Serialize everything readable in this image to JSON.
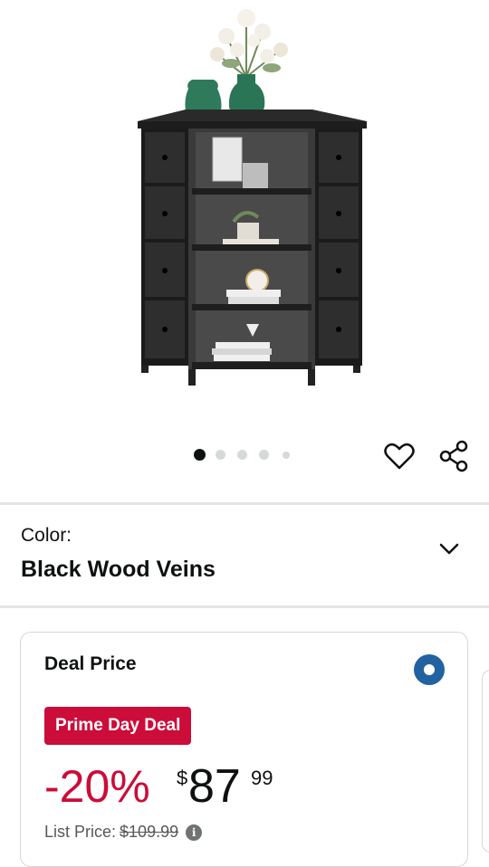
{
  "gallery": {
    "image_count": 5,
    "active_index": 0,
    "wishlist_icon": "heart-icon",
    "share_icon": "share-icon"
  },
  "color": {
    "label": "Color:",
    "value": "Black Wood Veins",
    "chevron_icon": "chevron-down-icon"
  },
  "deal": {
    "title": "Deal Price",
    "selected": true,
    "badge": "Prime Day Deal",
    "discount": "-20%",
    "currency": "$",
    "price_whole": "87",
    "price_fraction": "99",
    "list_price_label": "List Price:",
    "list_price": "$109.99",
    "info_icon": "info-icon"
  },
  "colors": {
    "deal_red": "#cc0c39",
    "radio_blue": "#2162a1"
  }
}
